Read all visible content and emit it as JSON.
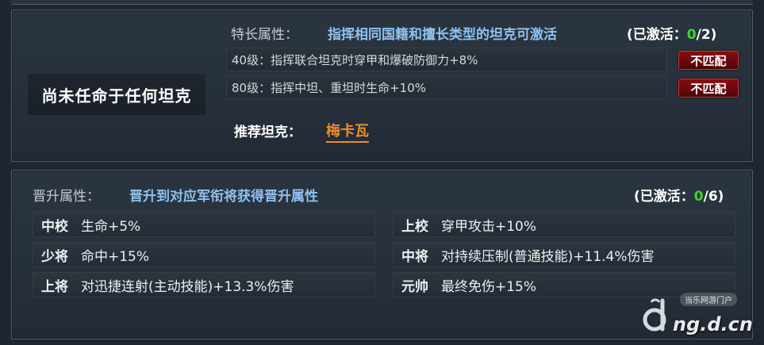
{
  "specialty": {
    "status_label": "尚未任命于任何坦克",
    "heading": "特长属性：",
    "description": "指挥相同国籍和擅长类型的坦克可激活",
    "activated_prefix": "(已激活：",
    "activated_count": "0",
    "activated_total": "/2)",
    "rows": [
      {
        "text": "40级：指挥联合坦克时穿甲和爆破防御力+8%",
        "badge": "不匹配"
      },
      {
        "text": "80级：指挥中坦、重坦时生命+10%",
        "badge": "不匹配"
      }
    ],
    "recommend_label": "推荐坦克：",
    "recommend_tank": "梅卡瓦"
  },
  "promotion": {
    "heading": "晋升属性：",
    "description": "晋升到对应军衔将获得晋升属性",
    "activated_prefix": "(已激活：",
    "activated_count": "0",
    "activated_total": "/6)",
    "rows": [
      {
        "rank": "中校",
        "bonus": "生命+5%"
      },
      {
        "rank": "上校",
        "bonus": "穿甲攻击+10%"
      },
      {
        "rank": "少将",
        "bonus": "命中+15%"
      },
      {
        "rank": "中将",
        "bonus": "对持续压制(普通技能)+11.4%伤害"
      },
      {
        "rank": "上将",
        "bonus": "对迅捷连射(主动技能)+13.3%伤害"
      },
      {
        "rank": "元帅",
        "bonus": "最终免伤+15%"
      }
    ]
  },
  "watermark": {
    "tag": "当乐网游门户",
    "site": "ng.d.cn"
  },
  "colors": {
    "accent_blue": "#8fc1f0",
    "activated_green": "#39d72a",
    "mismatch_red": "#8a0c10",
    "tank_orange": "#f08a2a"
  }
}
